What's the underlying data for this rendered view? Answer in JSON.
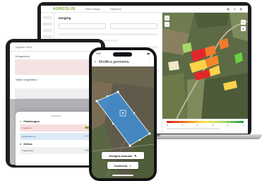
{
  "laptop": {
    "brand": "AGRICOLUS",
    "tabs": [
      "Editor mappa",
      "Irrigazione"
    ],
    "panel_title": "Imaging",
    "legend_colors": [
      "#d7191c",
      "#f07f24",
      "#fde64b",
      "#a6d96a",
      "#1a9641"
    ]
  },
  "tablet": {
    "header": "Vigneto 2024",
    "section_1": "Irrigazione",
    "section_2": "Stato vegetativo",
    "sheet": {
      "group_1": "Fabbisogno",
      "item_1": "Irrigazione",
      "item_2": "Fertilizzazione",
      "group_2": "Difesa",
      "item_3": "Trattamento"
    }
  },
  "phone": {
    "time": "9:41",
    "title": "Modifica geometria",
    "draw_button": "Disegna manuale",
    "confirm_button": "Conferma"
  },
  "icons": [
    "back-icon",
    "more-icon",
    "pencil-icon",
    "check-icon",
    "zoom-in-icon",
    "zoom-out-icon",
    "layers-icon"
  ]
}
